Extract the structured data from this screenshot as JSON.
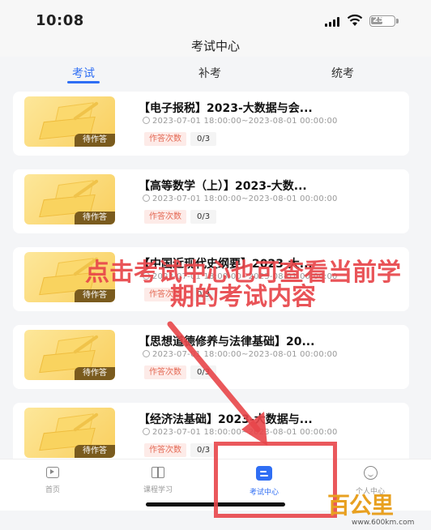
{
  "status_bar": {
    "time": "10:08",
    "battery": "25"
  },
  "header": {
    "title": "考试中心"
  },
  "tabs": [
    {
      "label": "考试",
      "active": true
    },
    {
      "label": "补考",
      "active": false
    },
    {
      "label": "统考",
      "active": false
    }
  ],
  "exams": [
    {
      "title": "【电子报税】2023-大数据与会...",
      "time": "2023-07-01 18:00:00~2023-08-01 00:00:00",
      "attempt_label": "作答次数",
      "attempts": "0/3",
      "status": "待作答"
    },
    {
      "title": "【高等数学（上）】2023-大数...",
      "time": "2023-07-01 18:00:00~2023-08-01 00:00:00",
      "attempt_label": "作答次数",
      "attempts": "0/3",
      "status": "待作答"
    },
    {
      "title": "【中国近现代史纲要】2023-大...",
      "time": "2023-07-01 18:00:00~2023-08-01 00:00:00",
      "attempt_label": "作答次数",
      "attempts": "0/3",
      "status": "待作答"
    },
    {
      "title": "【思想道德修养与法律基础】20...",
      "time": "2023-07-01 18:00:00~2023-08-01 00:00:00",
      "attempt_label": "作答次数",
      "attempts": "0/3",
      "status": "待作答"
    },
    {
      "title": "【经济法基础】2023-大数据与...",
      "time": "2023-07-01 18:00:00~2023-08-01 00:00:00",
      "attempt_label": "作答次数",
      "attempts": "0/3",
      "status": "待作答"
    }
  ],
  "tabbar": [
    {
      "label": "首页",
      "icon": "home-icon",
      "active": false
    },
    {
      "label": "课程学习",
      "icon": "book-icon",
      "active": false
    },
    {
      "label": "考试中心",
      "icon": "exam-icon",
      "active": true
    },
    {
      "label": "个人中心",
      "icon": "profile-icon",
      "active": false
    }
  ],
  "annotation": {
    "caption": "点击考试中心也可查看当前学期的考试内容",
    "color": "#e8464a"
  },
  "watermark": {
    "logo": "百公里",
    "url": "www.600km.com"
  },
  "colors": {
    "accent": "#2f6ef4",
    "badge_bg": "#7a5b1e",
    "attempt_label": "#e46a55"
  }
}
